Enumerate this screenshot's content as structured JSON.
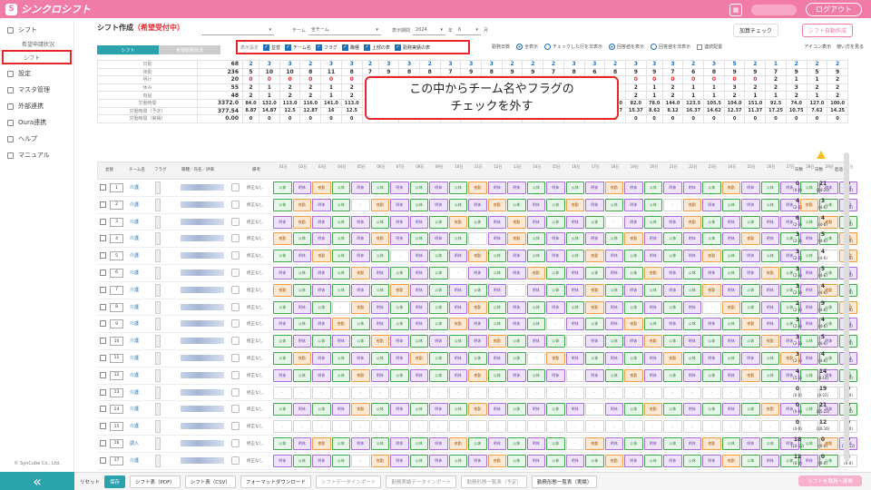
{
  "app": {
    "name": "シンクロシフト",
    "logout": "ログアウト"
  },
  "sidebar": {
    "items": [
      {
        "label": "シフト",
        "type": "group"
      },
      {
        "label": "希望申請状況",
        "type": "sub"
      },
      {
        "label": "シフト",
        "type": "highlight"
      },
      {
        "label": "設定",
        "type": "group"
      },
      {
        "label": "マスタ管理",
        "type": "group"
      },
      {
        "label": "外部連携",
        "type": "group"
      },
      {
        "label": "Oura連携",
        "type": "group"
      },
      {
        "label": "ヘルプ",
        "type": "group"
      },
      {
        "label": "マニュアル",
        "type": "group"
      }
    ],
    "copyright": "© SynCube Co., Ltd."
  },
  "page": {
    "title": "シフト作成",
    "status": "（希望受付中）"
  },
  "filters": {
    "team_label": "チーム",
    "team_value": "全チーム",
    "period_label": "表示期間",
    "year": "2024",
    "year_unit": "年",
    "month": "6",
    "month_unit": "月"
  },
  "buttons": {
    "check": "加算チェック",
    "auto": "シフト自動作成"
  },
  "tabs": [
    "シフト",
    "希望勤務状況"
  ],
  "checkbox_group": {
    "label": "表示設定",
    "items": [
      "並替",
      "チーム名",
      "フラグ",
      "職種",
      "上部の表",
      "勤務実績の表"
    ]
  },
  "radios": {
    "label": "勤務日数",
    "items": [
      {
        "label": "全表示",
        "on": true
      },
      {
        "label": "チェックした行を非表示",
        "on": false
      },
      {
        "label": "回答値を表示",
        "on": true
      },
      {
        "label": "回答値を非表示",
        "on": false
      }
    ]
  },
  "links": {
    "mode": "連続配置",
    "icon": "アイコン表示",
    "help": "使い方を見る"
  },
  "callout": {
    "line1": "この中からチーム名やフラグの",
    "line2": "チェックを外す"
  },
  "summary": {
    "labels": [
      "日勤",
      "夜勤",
      "明け",
      "休み",
      "有給",
      "労働時間",
      "労働時間（予定）",
      "労働時間（実績）"
    ],
    "totals": [
      "68",
      "236",
      "20",
      "55",
      "48",
      "3372.0",
      "377.54",
      "0.00"
    ],
    "rows": [
      [
        "2",
        "3",
        "3",
        "2",
        "3",
        "3",
        "2",
        "3",
        "3",
        "2",
        "3",
        "3",
        "3",
        "2",
        "2",
        "2",
        "3",
        "3",
        "2",
        "3",
        "3",
        "3",
        "2",
        "3",
        "5",
        "2",
        "1",
        "2",
        "2",
        "2"
      ],
      [
        "5",
        "10",
        "10",
        "8",
        "11",
        "8",
        "7",
        "9",
        "8",
        "8",
        "7",
        "9",
        "8",
        "9",
        "9",
        "7",
        "8",
        "6",
        "8",
        "9",
        "9",
        "7",
        "6",
        "8",
        "9",
        "9",
        "7",
        "9",
        "5",
        "9"
      ],
      [
        "0",
        "0",
        "0",
        "0",
        "0",
        "0",
        "0",
        "0",
        "0",
        "0",
        "0",
        "0",
        "0",
        "0",
        "0",
        "0",
        "0",
        "0",
        "0",
        "0",
        "0",
        "0",
        "0",
        "0",
        "0",
        "0",
        "2",
        "1",
        "1",
        "2"
      ],
      [
        "2",
        "1",
        "2",
        "2",
        "1",
        "2",
        "1",
        "2",
        "1",
        "2",
        "1",
        "2",
        "1",
        "2",
        "1",
        "2",
        "1",
        "2",
        "1",
        "2",
        "1",
        "2",
        "1",
        "1",
        "3",
        "2",
        "2",
        "3",
        "2",
        "2"
      ],
      [
        "2",
        "1",
        "2",
        "2",
        "1",
        "2",
        "1",
        "2",
        "1",
        "2",
        "1",
        "2",
        "1",
        "2",
        "1",
        "2",
        "1",
        "2",
        "1",
        "2",
        "1",
        "2",
        "1",
        "1",
        "2",
        "1",
        "1",
        "2",
        "1",
        "2"
      ],
      [
        "84.0",
        "132.0",
        "113.0",
        "116.0",
        "141.0",
        "113.0",
        "94.5",
        "101.0",
        "112.5",
        "104.0",
        "113.5",
        "110.0",
        "145.5",
        "89.0",
        "137.5",
        "135.5",
        "111.0",
        "112.0",
        "136.0",
        "82.0",
        "78.0",
        "144.0",
        "123.5",
        "105.5",
        "104.0",
        "151.0",
        "92.5",
        "74.0",
        "127.0",
        "100.0"
      ],
      [
        "8.87",
        "14.87",
        "12.5",
        "12.87",
        "16",
        "12.5",
        "11",
        "11",
        "13.25",
        "11.37",
        "13.37",
        "12.12",
        "15.75",
        "10.37",
        "9.5",
        "14.75",
        "16.12",
        "12.25",
        "12.37",
        "15.37",
        "8.62",
        "8.12",
        "16.37",
        "14.62",
        "12.37",
        "11.37",
        "17.25",
        "10.75",
        "7.62",
        "14.25"
      ],
      [
        "0",
        "0",
        "0",
        "0",
        "0",
        "0",
        "0",
        "0",
        "0",
        "0",
        "0",
        "0",
        "0",
        "0",
        "0",
        "0",
        "0",
        "0",
        "0",
        "0",
        "0",
        "0",
        "0",
        "0",
        "0",
        "0",
        "0",
        "0",
        "0",
        "0"
      ]
    ]
  },
  "table_header": {
    "col_no": "並替",
    "col_team": "チーム名",
    "col_flag": "フラグ",
    "col_name": "職種／氏名／評価",
    "col_memo": "備考",
    "stat1": "日数",
    "stat2": "日数",
    "stat3": "超過",
    "days": [
      "01日",
      "02日",
      "03日",
      "04日",
      "05日",
      "06日",
      "07日",
      "08日",
      "09日",
      "10日",
      "11日",
      "12日",
      "13日",
      "14日",
      "15日",
      "16日",
      "17日",
      "18日",
      "19日",
      "20日",
      "21日",
      "22日",
      "23日",
      "24日",
      "25日",
      "26日",
      "27日",
      "28日",
      "29日",
      "30日"
    ]
  },
  "row_codes": [
    "gpogpgpgpgoppgpgpopgppgopgpgpp",
    "gopgnopgpgpogpgopgpgnopgpgpogp",
    "popgpgppgogpopgpgnpgpogpgppgog",
    "ogpgpopgpgnpogpgpgopgpgpopgpgo",
    "gpogpgnpgpogpgpgopgpgpogpgpgno",
    "pgpgopgpgnpgpogpgpgopgpgpogpgp",
    "ogpgpgopgpgpnpgpogpgpgopgpgpog",
    "gpgnopgpgpogpgpgopgpgpnogpgpgo",
    "pgpogpgpgopgpgnpgpogpgpgopgpgp",
    "gpgpgopgpgpogpgnpgpogpgpgopgpg",
    "gopgpgpogpgpgnopgpgpogpgpgopgp",
    "pgpgopgpgpogpgpnpgopgpgpogpgpg",
    "nnnnnnnnnnnnnnnnnnnnnnnnnnnnnn",
    "gpgpogpgpgopgpgpnpgogpgpgopgpg",
    "nnnnnnnnnnnnnnnnnnnnnnnnnnnnnn",
    "gpogpgpgpogpgpgnopgpgpogpgpgop",
    "pgpgnopgpgpogpgpgopgpgpogpgpgn"
  ],
  "rows": [
    {
      "no": "1",
      "team": "介護",
      "memo": "修正なし",
      "s1": "0",
      "s1b": "(0-0)",
      "s2": "21",
      "s2b": "(14-20)",
      "s3": "0",
      "s3b": "(0-0)"
    },
    {
      "no": "2",
      "team": "介護",
      "memo": "修正なし",
      "s1": "4",
      "s1b": "(2-3)",
      "s2": "3",
      "s2b": "(4-6)",
      "s3": "1",
      "s3b": "(0-0)"
    },
    {
      "no": "3",
      "team": "介護",
      "memo": "修正なし",
      "s1": "6",
      "s1b": "(2-3)",
      "s2": "4",
      "s2b": "(4-6)",
      "s3": "1",
      "s3b": "(0-0)"
    },
    {
      "no": "4",
      "team": "介護",
      "memo": "修正なし",
      "s1": "3",
      "s1b": "(2-3)",
      "s2": "5",
      "s2b": "(4-6)",
      "s3": "1",
      "s3b": "(0-0)"
    },
    {
      "no": "5",
      "team": "介護",
      "memo": "修正なし",
      "s1": "3",
      "s1b": "(2-3)",
      "s2": "4",
      "s2b": "(4-6)",
      "s3": "2",
      "s3b": "(0-0)"
    },
    {
      "no": "6",
      "team": "介護",
      "memo": "修正なし",
      "s1": "3",
      "s1b": "(2-3)",
      "s2": "5",
      "s2b": "(4-6)",
      "s3": "1",
      "s3b": "(0-0)"
    },
    {
      "no": "7",
      "team": "介護",
      "memo": "修正なし",
      "s1": "3",
      "s1b": "(2-3)",
      "s2": "4",
      "s2b": "(4-6)",
      "s3": "3",
      "s3b": "(0-0)"
    },
    {
      "no": "8",
      "team": "介護",
      "memo": "修正なし",
      "s1": "2",
      "s1b": "(2-3)",
      "s2": "9",
      "s2b": "(4-6)",
      "s3": "1",
      "s3b": "(0-0)"
    },
    {
      "no": "9",
      "team": "介護",
      "memo": "修正なし",
      "s1": "3",
      "s1b": "(2-3)",
      "s2": "4",
      "s2b": "(4-6)",
      "s3": "2",
      "s3b": "(0-0)"
    },
    {
      "no": "10",
      "team": "介護",
      "memo": "修正なし",
      "s1": "3",
      "s1b": "(2-3)",
      "s2": "5",
      "s2b": "(4-6)",
      "s3": "3",
      "s3b": "(0-0)"
    },
    {
      "no": "11",
      "team": "介護",
      "memo": "修正なし",
      "s1": "3",
      "s1b": "(2-3)",
      "s2": "4",
      "s2b": "(4-6)",
      "s3": "3",
      "s3b": "(0-0)"
    },
    {
      "no": "12",
      "team": "介護",
      "memo": "修正なし",
      "s1": "4",
      "s1b": "(5-5)",
      "s2": "14",
      "s2b": "(8-14)",
      "s3": "1",
      "s3b": "(0-0)"
    },
    {
      "no": "13",
      "team": "介護",
      "memo": "修正なし",
      "s1": "0",
      "s1b": "(0-0)",
      "s2": "19",
      "s2b": "(0-22)",
      "s3": "0",
      "s3b": "(0-0)"
    },
    {
      "no": "14",
      "team": "介護",
      "memo": "修正なし",
      "s1": "0",
      "s1b": "(0-0)",
      "s2": "21",
      "s2b": "(15-22)",
      "s3": "0",
      "s3b": "(0-0)"
    },
    {
      "no": "15",
      "team": "介護",
      "memo": "修正なし",
      "s1": "0",
      "s1b": "(0-0)",
      "s2": "12",
      "s2b": "(10-16)",
      "s3": "0",
      "s3b": "(0-0)"
    },
    {
      "no": "16",
      "team": "調入",
      "memo": "修正なし",
      "s1": "18",
      "s1b": "(10-12)",
      "s2": "0",
      "s2b": "(0-0)",
      "s3": "0",
      "s3b": "(10-12)"
    },
    {
      "no": "17",
      "team": "介護",
      "memo": "修正なし",
      "s1": "12",
      "s1b": "(0-0)",
      "s2": "0",
      "s2b": "(0-0)",
      "s3": "5",
      "s3b": "(0-0)"
    }
  ],
  "cell_labels": {
    "g": "公休",
    "p": "明休",
    "o": "夜勤",
    "n": "-"
  },
  "bottom": {
    "reset": "リセット",
    "save": "保存",
    "b1": "シフト表（PDF）",
    "b2": "シフト表（CSV）",
    "b3": "フォーマットダウンロード",
    "b4": "シフトデータインポート",
    "b5": "勤務実績データインポート",
    "b6": "勤務形態一覧表（予定）",
    "b7": "勤務形態一覧表（実績）",
    "confirm": "シフトを職員へ展開"
  }
}
